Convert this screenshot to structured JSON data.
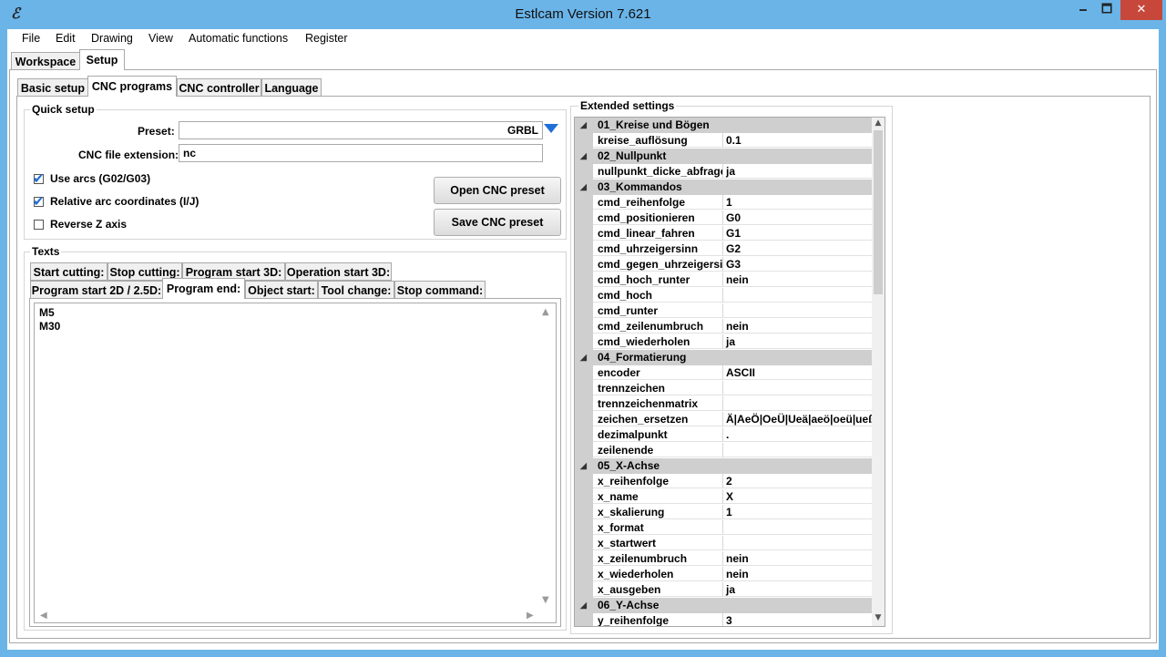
{
  "window": {
    "title": "Estlcam Version 7.621",
    "minimize": "🗕",
    "maximize": "🗖",
    "close": "✕",
    "app_icon": "ℰ"
  },
  "menu": [
    "File",
    "Edit",
    "Drawing",
    "View",
    "Automatic functions",
    "Register"
  ],
  "main_tabs": [
    "Workspace",
    "Setup"
  ],
  "setup_tabs": [
    "Basic setup",
    "CNC programs",
    "CNC controller",
    "Language"
  ],
  "quick_setup": {
    "title": "Quick setup",
    "preset_label": "Preset:",
    "preset_value": "GRBL",
    "ext_label": "CNC file extension:",
    "ext_value": "nc",
    "checkboxes": [
      {
        "label": "Use arcs (G02/G03)",
        "checked": true
      },
      {
        "label": "Relative arc coordinates (I/J)",
        "checked": true
      },
      {
        "label": "Reverse Z axis",
        "checked": false
      }
    ],
    "open_button": "Open CNC preset",
    "save_button": "Save CNC preset"
  },
  "texts": {
    "title": "Texts",
    "tabs_row1": [
      "Start cutting:",
      "Stop cutting:",
      "Program start 3D:",
      "Operation start 3D:"
    ],
    "tabs_row2": [
      "Program start 2D / 2.5D:",
      "Program end:",
      "Object start:",
      "Tool change:",
      "Stop command:"
    ],
    "content_lines": [
      "M5",
      "M30"
    ]
  },
  "extended": {
    "title": "Extended settings",
    "rows": [
      {
        "type": "cat",
        "name": "01_Kreise und Bögen"
      },
      {
        "type": "prop",
        "name": "kreise_auflösung",
        "value": "0.1"
      },
      {
        "type": "cat",
        "name": "02_Nullpunkt"
      },
      {
        "type": "prop",
        "name": "nullpunkt_dicke_abfrage",
        "value": "ja"
      },
      {
        "type": "cat",
        "name": "03_Kommandos"
      },
      {
        "type": "prop",
        "name": "cmd_reihenfolge",
        "value": "1"
      },
      {
        "type": "prop",
        "name": "cmd_positionieren",
        "value": "G0"
      },
      {
        "type": "prop",
        "name": "cmd_linear_fahren",
        "value": "G1"
      },
      {
        "type": "prop",
        "name": "cmd_uhrzeigersinn",
        "value": "G2"
      },
      {
        "type": "prop",
        "name": "cmd_gegen_uhrzeigersinn",
        "value": "G3"
      },
      {
        "type": "prop",
        "name": "cmd_hoch_runter",
        "value": "nein"
      },
      {
        "type": "prop",
        "name": "cmd_hoch",
        "value": ""
      },
      {
        "type": "prop",
        "name": "cmd_runter",
        "value": ""
      },
      {
        "type": "prop",
        "name": "cmd_zeilenumbruch",
        "value": "nein"
      },
      {
        "type": "prop",
        "name": "cmd_wiederholen",
        "value": "ja"
      },
      {
        "type": "cat",
        "name": "04_Formatierung"
      },
      {
        "type": "prop",
        "name": "encoder",
        "value": "ASCII"
      },
      {
        "type": "prop",
        "name": "trennzeichen",
        "value": ""
      },
      {
        "type": "prop",
        "name": "trennzeichenmatrix",
        "value": ""
      },
      {
        "type": "prop",
        "name": "zeichen_ersetzen",
        "value": "Ä|AeÖ|OeÜ|Ueä|aeö|oeü|ueß"
      },
      {
        "type": "prop",
        "name": "dezimalpunkt",
        "value": "."
      },
      {
        "type": "prop",
        "name": "zeilenende",
        "value": ""
      },
      {
        "type": "cat",
        "name": "05_X-Achse"
      },
      {
        "type": "prop",
        "name": "x_reihenfolge",
        "value": "2"
      },
      {
        "type": "prop",
        "name": "x_name",
        "value": "X"
      },
      {
        "type": "prop",
        "name": "x_skalierung",
        "value": "1"
      },
      {
        "type": "prop",
        "name": "x_format",
        "value": ""
      },
      {
        "type": "prop",
        "name": "x_startwert",
        "value": ""
      },
      {
        "type": "prop",
        "name": "x_zeilenumbruch",
        "value": "nein"
      },
      {
        "type": "prop",
        "name": "x_wiederholen",
        "value": "nein"
      },
      {
        "type": "prop",
        "name": "x_ausgeben",
        "value": "ja"
      },
      {
        "type": "cat",
        "name": "06_Y-Achse"
      },
      {
        "type": "prop",
        "name": "y_reihenfolge",
        "value": "3"
      }
    ]
  },
  "colors": {
    "titlebar": "#6ab4e8",
    "close": "#c7473a",
    "check": "#1f6fd6",
    "category": "#cfcfcf"
  }
}
